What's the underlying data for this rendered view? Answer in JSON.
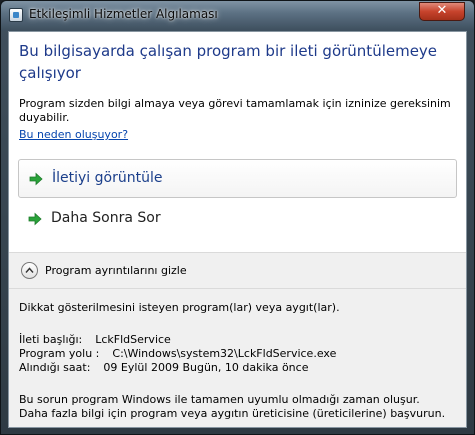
{
  "window": {
    "title": "Etkileşimli Hizmetler Algılaması",
    "close_symbol": "✕"
  },
  "main": {
    "heading": "Bu bilgisayarda çalışan program bir ileti görüntülemeye çalışıyor",
    "description": "Program sizden bilgi almaya veya görevi tamamlamak için izninize gereksinim duyabilir.",
    "why_link": "Bu neden oluşuyor?"
  },
  "options": [
    {
      "label": "İletiyi görüntüle",
      "icon": "green-arrow-icon"
    },
    {
      "label": "Daha Sonra Sor",
      "icon": "green-arrow-icon"
    }
  ],
  "details": {
    "toggle_label": "Program ayrıntılarını gizle",
    "intro": "Dikkat gösterilmesini isteyen program(lar) veya aygıt(lar).",
    "fields": [
      {
        "key": "İleti başlığı:",
        "value": "LckFldService"
      },
      {
        "key": "Program yolu :",
        "value": "C:\\Windows\\system32\\LckFldService.exe"
      },
      {
        "key": "Alındığı saat:",
        "value": "09 Eylül 2009 Bugün, 10 dakika önce"
      }
    ],
    "footer_line1": "Bu sorun program Windows ile tamamen uyumlu olmadığı zaman oluşur.",
    "footer_line2": "Daha fazla bilgi için program veya aygıtın üreticisine (üreticilerine) başvurun."
  },
  "colors": {
    "heading": "#1e3a8a",
    "link": "#0645ad",
    "arrow": "#2aa33a",
    "close": "#c7432c"
  }
}
